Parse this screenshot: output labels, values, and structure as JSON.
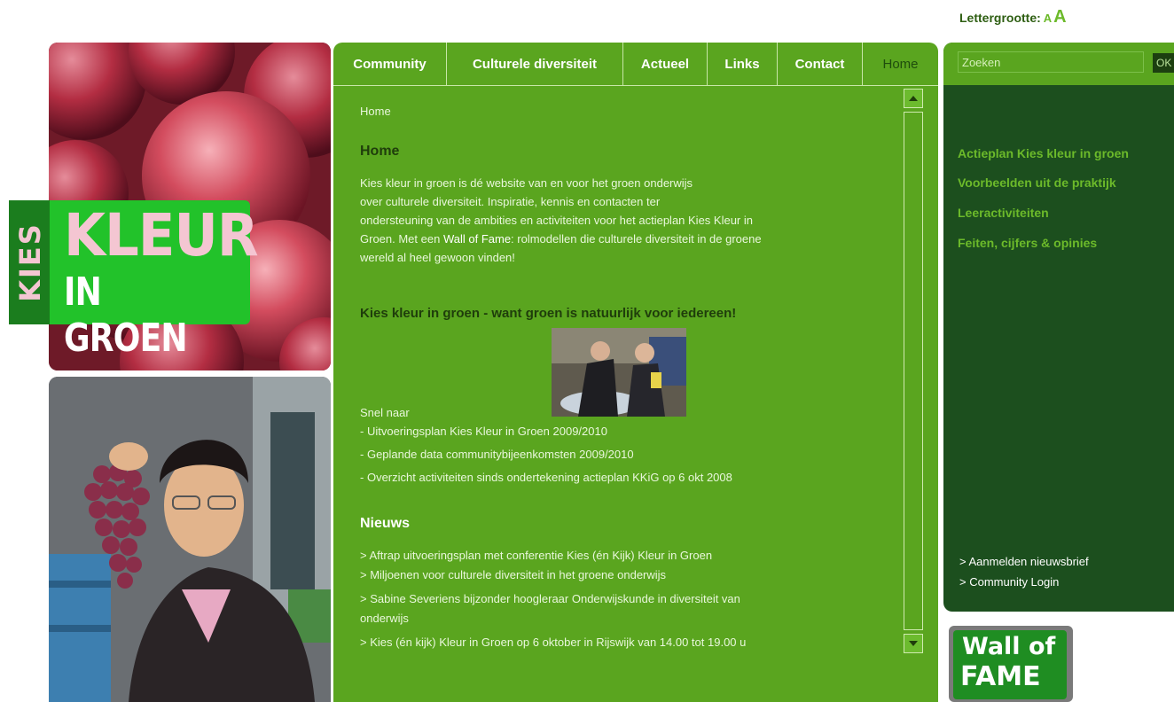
{
  "header": {
    "fontsize_label": "Lettergrootte:",
    "fontsize_small": "A",
    "fontsize_large": "A"
  },
  "logo": {
    "kies": "KIES",
    "kleur": "KLEUR",
    "in_groen": "IN GROEN"
  },
  "nav": {
    "tabs": [
      {
        "label": "Community"
      },
      {
        "label": "Culturele diversiteit"
      },
      {
        "label": "Actueel"
      },
      {
        "label": "Links"
      },
      {
        "label": "Contact"
      },
      {
        "label": "Home"
      }
    ]
  },
  "content": {
    "breadcrumb": "Home",
    "heading": "Home",
    "intro": {
      "line1": "Kies kleur in groen is dé website van en voor het groen onderwijs",
      "line2": "over culturele diversiteit. Inspiratie, kennis en contacten ter",
      "line3": "ondersteuning van de ambities en activiteiten voor het actieplan Kies Kleur in",
      "line4_pre": "Groen. Met een ",
      "line4_link": "Wall of Fame",
      "line4_post": ": rolmodellen die culturele diversiteit in de groene",
      "line5": "wereld al heel gewoon vinden!"
    },
    "slogan": "Kies kleur in groen - want groen is natuurlijk voor iedereen!",
    "snel_naar": "Snel naar",
    "quick_links": [
      {
        "dash": "- ",
        "link": "Uitvoeringsplan",
        "rest": " Kies Kleur in Groen 2009/2010"
      },
      {
        "dash": "- ",
        "link": "Geplande data",
        "rest": " communitybijeenkomsten 2009/2010"
      },
      {
        "dash": "- ",
        "link": "Overzicht activiteiten",
        "rest": " sinds ondertekening actieplan KKiG op 6 okt 2008"
      }
    ],
    "news_heading": "Nieuws",
    "news": [
      "> Aftrap uitvoeringsplan met conferentie Kies (én Kijk) Kleur in Groen",
      "> Miljoenen voor culturele diversiteit in het groene onderwijs",
      "> Sabine Severiens bijzonder hoogleraar Onderwijskunde in diversiteit van",
      "onderwijs",
      "> Kies (én kijk) Kleur in Groen op 6 oktober in Rijswijk van 14.00 tot 19.00 u"
    ]
  },
  "sidebar": {
    "search_placeholder": "Zoeken",
    "search_button": "OK",
    "menu": [
      "Actieplan Kies kleur in groen",
      "Voorbeelden uit de praktijk",
      "Leeractiviteiten",
      "Feiten, cijfers & opinies"
    ],
    "links": [
      "> Aanmelden nieuwsbrief",
      "> Community Login"
    ]
  },
  "wall_of_fame": {
    "line1": "Wall of",
    "line2": "FAME"
  },
  "colors": {
    "primary_green": "#5aa51f",
    "dark_green": "#1c4f1e",
    "accent_light_green": "#6cba2a",
    "logo_pink": "#f4c6d2"
  }
}
